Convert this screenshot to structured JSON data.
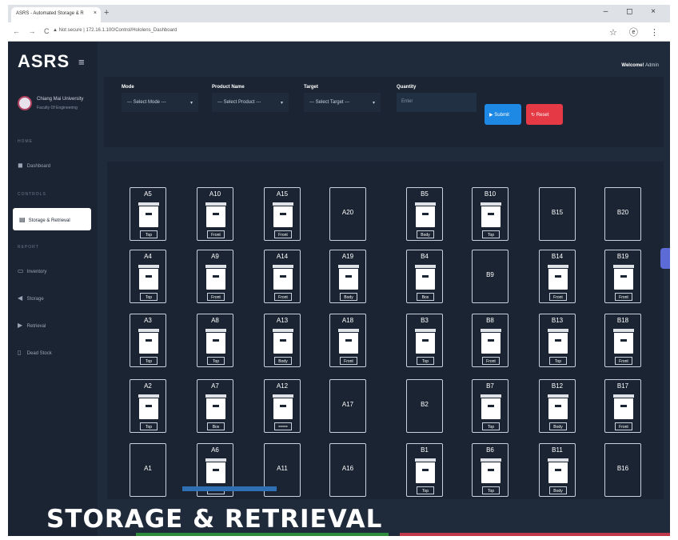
{
  "browser": {
    "tab_title": "ASRS - Automated Storage & R",
    "tab_close": "×",
    "new_tab": "+",
    "window_controls": "– ◻ ×",
    "nav": "← → C",
    "url": "▲ Not secure | 172.16.1.100/Control/Hololens_Dashboard",
    "addr_right": "☆ ⓔ ⋮"
  },
  "sidebar": {
    "logo": "ASRS",
    "menu_icon": "≡",
    "university": "Chiang Mai University",
    "faculty": "Faculty Of Engineering",
    "sections": {
      "home": "HOME",
      "controls": "CONTROLS",
      "report": "REPORT"
    },
    "items": [
      {
        "label": "Dashboard",
        "icon": "dashboard-icon",
        "glyph": "◼"
      },
      {
        "label": "Storage & Retrieval",
        "icon": "storage-icon",
        "glyph": "▤",
        "active": true
      },
      {
        "label": "Inventory",
        "icon": "inventory-icon",
        "glyph": "▭"
      },
      {
        "label": "Storage",
        "icon": "storage-report-icon",
        "glyph": "◀"
      },
      {
        "label": "Retrieval",
        "icon": "retrieval-icon",
        "glyph": "▶"
      },
      {
        "label": "Dead Stock",
        "icon": "deadstock-icon",
        "glyph": "▯"
      }
    ]
  },
  "header": {
    "welcome": "Welcome!",
    "user": "Admin"
  },
  "form": {
    "mode": {
      "label": "Mode",
      "value": "--- Select Mode ---"
    },
    "product": {
      "label": "Product Name",
      "value": "--- Select Product ---"
    },
    "target": {
      "label": "Target",
      "value": "--- Select Target ---"
    },
    "quantity": {
      "label": "Quantity",
      "placeholder": "Enter"
    },
    "submit": "Submit",
    "reset": "Reset",
    "caret": "▾"
  },
  "storage_grid": [
    {
      "id": "A5",
      "filled": true,
      "tag": "Top"
    },
    {
      "id": "A10",
      "filled": true,
      "tag": "Front"
    },
    {
      "id": "A15",
      "filled": true,
      "tag": "Front"
    },
    {
      "id": "A20",
      "filled": false,
      "tag": ""
    },
    {
      "id": "B5",
      "filled": true,
      "tag": "Body"
    },
    {
      "id": "B10",
      "filled": true,
      "tag": "Top"
    },
    {
      "id": "B15",
      "filled": false,
      "tag": ""
    },
    {
      "id": "B20",
      "filled": false,
      "tag": ""
    },
    {
      "id": "A4",
      "filled": true,
      "tag": "Top"
    },
    {
      "id": "A9",
      "filled": true,
      "tag": "Front"
    },
    {
      "id": "A14",
      "filled": true,
      "tag": "Front"
    },
    {
      "id": "A19",
      "filled": true,
      "tag": "Body"
    },
    {
      "id": "B4",
      "filled": true,
      "tag": "Box"
    },
    {
      "id": "B9",
      "filled": false,
      "tag": ""
    },
    {
      "id": "B14",
      "filled": true,
      "tag": "Front"
    },
    {
      "id": "B19",
      "filled": true,
      "tag": "Front"
    },
    {
      "id": "A3",
      "filled": true,
      "tag": "Top"
    },
    {
      "id": "A8",
      "filled": true,
      "tag": "Top"
    },
    {
      "id": "A13",
      "filled": true,
      "tag": "Body"
    },
    {
      "id": "A18",
      "filled": true,
      "tag": "Front"
    },
    {
      "id": "B3",
      "filled": true,
      "tag": "Top"
    },
    {
      "id": "B8",
      "filled": true,
      "tag": "Front"
    },
    {
      "id": "B13",
      "filled": true,
      "tag": "Top"
    },
    {
      "id": "B18",
      "filled": true,
      "tag": "Front"
    },
    {
      "id": "A2",
      "filled": true,
      "tag": "Top"
    },
    {
      "id": "A7",
      "filled": true,
      "tag": "Box"
    },
    {
      "id": "A12",
      "filled": true,
      "tag": "===="
    },
    {
      "id": "A17",
      "filled": false,
      "tag": ""
    },
    {
      "id": "B2",
      "filled": false,
      "tag": ""
    },
    {
      "id": "B7",
      "filled": true,
      "tag": "Top"
    },
    {
      "id": "B12",
      "filled": true,
      "tag": "Body"
    },
    {
      "id": "B17",
      "filled": true,
      "tag": "Front"
    },
    {
      "id": "A1",
      "filled": false,
      "tag": ""
    },
    {
      "id": "A6",
      "filled": true,
      "tag": ""
    },
    {
      "id": "A11",
      "filled": false,
      "tag": ""
    },
    {
      "id": "A16",
      "filled": false,
      "tag": ""
    },
    {
      "id": "B1",
      "filled": true,
      "tag": "Top"
    },
    {
      "id": "B6",
      "filled": true,
      "tag": "Top"
    },
    {
      "id": "B11",
      "filled": true,
      "tag": "Body"
    },
    {
      "id": "B16",
      "filled": false,
      "tag": ""
    }
  ],
  "caption": "STORAGE & RETRIEVAL",
  "colors": {
    "submit": "#1e88e5",
    "reset": "#e53945",
    "bg": "#1f2a3a"
  }
}
